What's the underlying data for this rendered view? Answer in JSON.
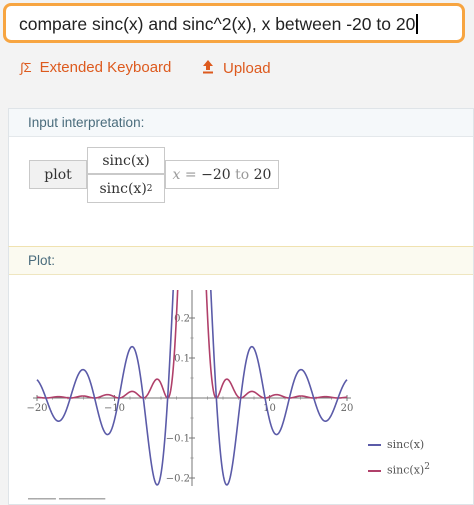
{
  "search": {
    "query": "compare sinc(x) and sinc^2(x),  x between -20 to 20"
  },
  "tools": {
    "keyboard_label": "Extended Keyboard",
    "upload_label": "Upload"
  },
  "input_pod": {
    "title": "Input interpretation:",
    "command": "plot",
    "func1": "sinc(x)",
    "func2_base": "sinc(x)",
    "func2_exp": "2",
    "range_var": "x",
    "range_eq": "=",
    "range_from": "−20",
    "range_to_word": "to",
    "range_to": "20"
  },
  "plot_pod": {
    "title": "Plot:"
  },
  "legend": {
    "series1": "sinc(x)",
    "series2_base": "sinc(x)",
    "series2_exp": "2"
  },
  "chart_data": {
    "type": "line",
    "xlim": [
      -20,
      20
    ],
    "ylim": [
      -0.22,
      0.26
    ],
    "x_ticks": [
      -20,
      -10,
      10,
      20
    ],
    "x_tick_labels": [
      "−20",
      "−10",
      "10",
      "20"
    ],
    "y_ticks": [
      0.2,
      0.1,
      -0.1,
      -0.2
    ],
    "y_tick_labels": [
      "0.2",
      "0.1",
      "−0.1",
      "−0.2"
    ],
    "series": [
      {
        "name": "sinc(x)",
        "function": "sin(x)/x",
        "color": "#5b5ba8"
      },
      {
        "name": "sinc(x)^2",
        "function": "(sin(x)/x)^2",
        "color": "#b0406a"
      }
    ]
  },
  "colors": {
    "accent": "#f7a541",
    "link": "#dd5a1e",
    "sinc": "#5b5ba8",
    "sinc2": "#b0406a"
  }
}
